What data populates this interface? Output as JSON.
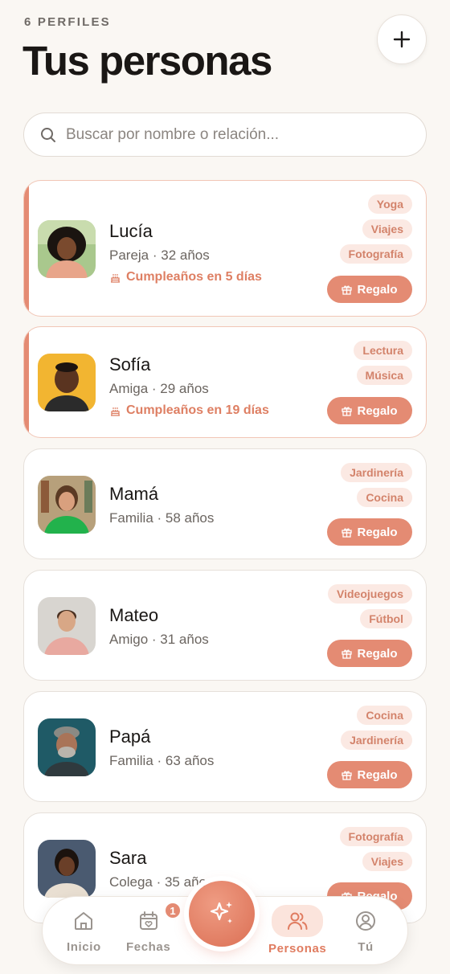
{
  "header": {
    "count_label": "6 PERFILES",
    "title": "Tus personas",
    "add_icon": "plus-icon"
  },
  "search": {
    "placeholder": "Buscar por nombre o relación...",
    "value": ""
  },
  "gift_label": "Regalo",
  "people": [
    {
      "name": "Lucía",
      "meta": "Pareja · 32 años",
      "birthday": "Cumpleaños en 5 días",
      "tags": [
        "Yoga",
        "Viajes",
        "Fotografía"
      ]
    },
    {
      "name": "Sofía",
      "meta": "Amiga · 29 años",
      "birthday": "Cumpleaños en 19 días",
      "tags": [
        "Lectura",
        "Música"
      ]
    },
    {
      "name": "Mamá",
      "meta": "Familia · 58 años",
      "tags": [
        "Jardinería",
        "Cocina"
      ]
    },
    {
      "name": "Mateo",
      "meta": "Amigo · 31 años",
      "tags": [
        "Videojuegos",
        "Fútbol"
      ]
    },
    {
      "name": "Papá",
      "meta": "Familia · 63 años",
      "tags": [
        "Cocina",
        "Jardinería"
      ]
    },
    {
      "name": "Sara",
      "meta": "Colega · 35 años",
      "tags": [
        "Fotografía",
        "Viajes"
      ]
    }
  ],
  "nav": {
    "items": [
      {
        "label": "Inicio",
        "icon": "home-icon"
      },
      {
        "label": "Fechas",
        "icon": "calendar-heart-icon",
        "badge": "1"
      },
      {
        "label": "Personas",
        "icon": "people-icon"
      },
      {
        "label": "Tú",
        "icon": "user-circle-icon"
      }
    ],
    "fab_icon": "sparkles-icon"
  },
  "colors": {
    "accent": "#e48b73",
    "tag_bg": "#fbe9e3",
    "background": "#faf7f3"
  }
}
